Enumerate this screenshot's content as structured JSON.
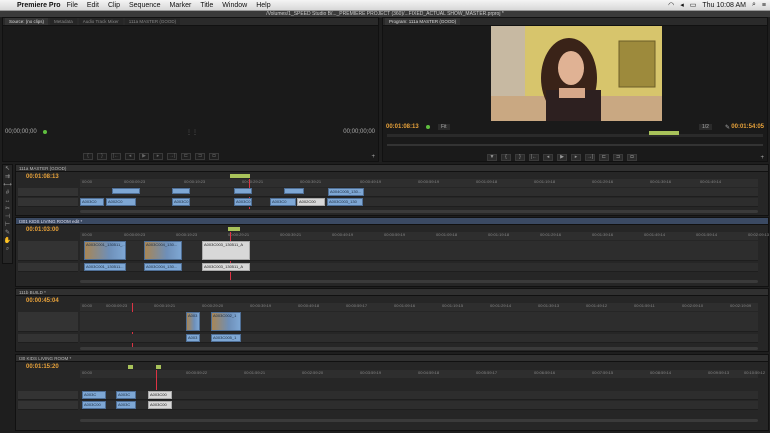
{
  "menubar": {
    "app": "Premiere Pro",
    "items": [
      "File",
      "Edit",
      "Clip",
      "Sequence",
      "Marker",
      "Title",
      "Window",
      "Help"
    ],
    "clock": "Thu 10:08 AM"
  },
  "titlebar": {
    "text": "/Volumes/1_SPEED Studio B/..._PREMIERE PROJECT (360)/...FIXED_ACTUAL SHOW_MASTER.prproj *"
  },
  "source_monitor": {
    "tabs": [
      "Source: (no clips)",
      "Metadata",
      "Audio Track Mixer",
      "111a MASTER (GOOD)"
    ],
    "tc_left": "00;00;00;00",
    "tc_right": "00;00;00;00"
  },
  "program_monitor": {
    "tab": "Program: 111a MASTER (GOOD)",
    "tc_left": "00:01:08:13",
    "fit": "Fit",
    "quality": "1/2",
    "tc_right": "00:01:54:05"
  },
  "sequences": [
    {
      "tab": "111a MASTER (GOOD)",
      "tc": "00:01:08:13",
      "ruler": [
        "00:00",
        "00:00:09:23",
        "00:00:19:23",
        "00:00:29:21",
        "00:00:39:21",
        "00:00:49:19",
        "00:00:59:19",
        "00:01:09:18",
        "00:01:19:18",
        "00:01:29:16",
        "00:01:39:16",
        "00:01:49:14",
        "00:01:59:14"
      ],
      "clips_top": [
        "",
        "",
        "",
        "",
        "A004C005_130..."
      ],
      "clips_bottom": [
        "A003C0",
        "A002C0",
        "A003C0",
        "A003C0",
        "A003C0",
        "A002C00",
        "A003C003_130"
      ]
    },
    {
      "tab": "I301 KIDS LIVING ROOM edit *",
      "tc": "00:01:03:00",
      "ruler": [
        "00:00",
        "00:00:09:23",
        "00:00:19:23",
        "00:00:29:21",
        "00:00:39:21",
        "00:00:49:19",
        "00:00:59:19",
        "00:01:09:18",
        "00:01:19:18",
        "00:01:29:16",
        "00:01:39:16",
        "00:01:49:14",
        "00:01:59:14",
        "00:02:09:13"
      ],
      "clips_top": [
        "A003C001_130511_...",
        "A003C004_130...",
        "A003C003_130511_A"
      ],
      "clips_bottom": [
        "A003C001_130511...",
        "A003C004_130...",
        "A003C003_130511_A"
      ]
    },
    {
      "tab": "111b BUILD *",
      "tc": "00:00:45:04",
      "ruler": [
        "00:00",
        "00:00:09:23",
        "00:00:19:21",
        "00:00:29:20",
        "00:00:39:19",
        "00:00:49:18",
        "00:00:59:17",
        "00:01:09:16",
        "00:01:19:15",
        "00:01:29:14",
        "00:01:39:13",
        "00:01:49:12",
        "00:01:59:11",
        "00:02:09:10",
        "00:02:19:09"
      ],
      "clips_top": [
        "A003",
        "A003C002_1"
      ],
      "clips_bottom": [
        "A003",
        "A003C005_1"
      ]
    },
    {
      "tab": "I30 KIDS LIVING ROOM *",
      "tc": "00:01:15:20",
      "ruler": [
        "00:00",
        "00:00:59:22",
        "00:01:59:21",
        "00:02:59:20",
        "00:03:59:19",
        "00:04:59:18",
        "00:05:59:17",
        "00:06:59:16",
        "00:07:59:15",
        "00:08:59:14",
        "00:09:59:13",
        "00:10:59:12",
        "00:11:59:11"
      ],
      "clips_top": [
        "A003C",
        "A003C",
        "A003C00"
      ],
      "clips_bottom": [
        "A003C00",
        "A003C",
        "A003C00"
      ]
    }
  ]
}
